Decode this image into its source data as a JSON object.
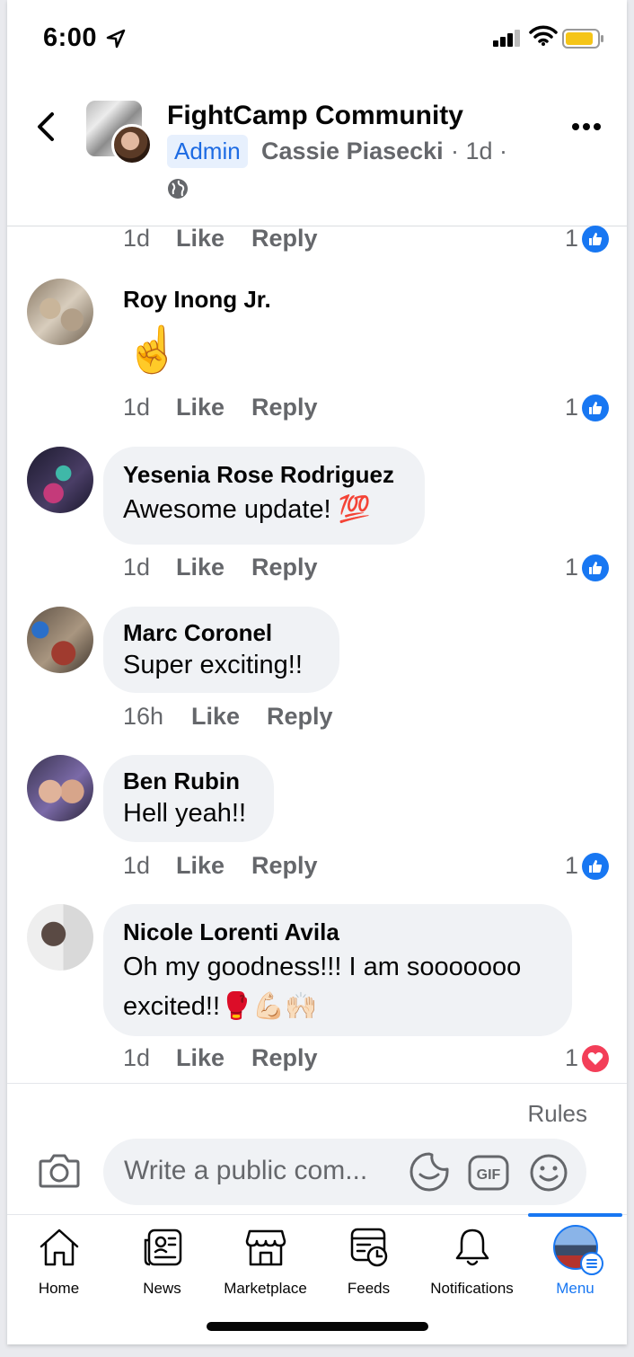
{
  "status_bar": {
    "time": "6:00"
  },
  "header": {
    "group_name": "FightCamp Community",
    "badge": "Admin",
    "author": "Cassie Piasecki",
    "meta": "· 1d ·"
  },
  "actions": {
    "like": "Like",
    "reply": "Reply"
  },
  "comments": [
    {
      "time": "1d",
      "reaction_count": "1",
      "reaction": "like-icon"
    },
    {
      "name": "Roy Inong Jr.",
      "text": "☝️",
      "time": "1d",
      "reaction_count": "1",
      "reaction": "like-icon"
    },
    {
      "name": "Yesenia Rose Rodriguez",
      "text": "Awesome update! 💯",
      "time": "1d",
      "reaction_count": "1",
      "reaction": "like-icon"
    },
    {
      "name": "Marc Coronel",
      "text": "Super exciting!!",
      "time": "16h"
    },
    {
      "name": "Ben Rubin",
      "text": "Hell yeah!!",
      "time": "1d",
      "reaction_count": "1",
      "reaction": "like-icon"
    },
    {
      "name": "Nicole Lorenti Avila",
      "text_line1": "Oh my goodness!!! I am sooooooo",
      "text_line2": "excited!!🥊💪🏻🙌🏻",
      "time": "1d",
      "reaction_count": "1",
      "reaction": "love-icon"
    }
  ],
  "composer": {
    "rules": "Rules",
    "placeholder": "Write a public com..."
  },
  "tabs": [
    {
      "label": "Home",
      "icon": "home-icon"
    },
    {
      "label": "News",
      "icon": "news-icon"
    },
    {
      "label": "Marketplace",
      "icon": "marketplace-icon"
    },
    {
      "label": "Feeds",
      "icon": "feeds-icon"
    },
    {
      "label": "Notifications",
      "icon": "bell-icon"
    },
    {
      "label": "Menu",
      "icon": "menu-avatar",
      "active": true
    }
  ],
  "colors": {
    "accent": "#1877f2",
    "admin_bg": "#e7f0fd",
    "bubble": "#f0f2f5",
    "love": "#f33e58"
  }
}
